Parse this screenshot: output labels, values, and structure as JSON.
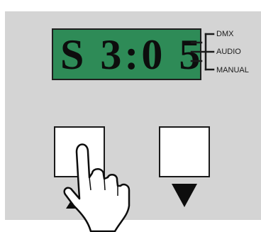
{
  "display": {
    "text": "S 3:0 5"
  },
  "modes": [
    {
      "label": "DMX"
    },
    {
      "label": "AUDIO"
    },
    {
      "label": "MANUAL"
    }
  ],
  "colors": {
    "panel": "#d4d4d4",
    "lcd": "#2e8b57",
    "lcd_text": "#0d0d0d"
  },
  "buttons": {
    "up": {
      "icon": "up-arrow-icon"
    },
    "down": {
      "icon": "down-arrow-icon"
    }
  },
  "illustration": {
    "icon": "pointing-hand-icon"
  }
}
